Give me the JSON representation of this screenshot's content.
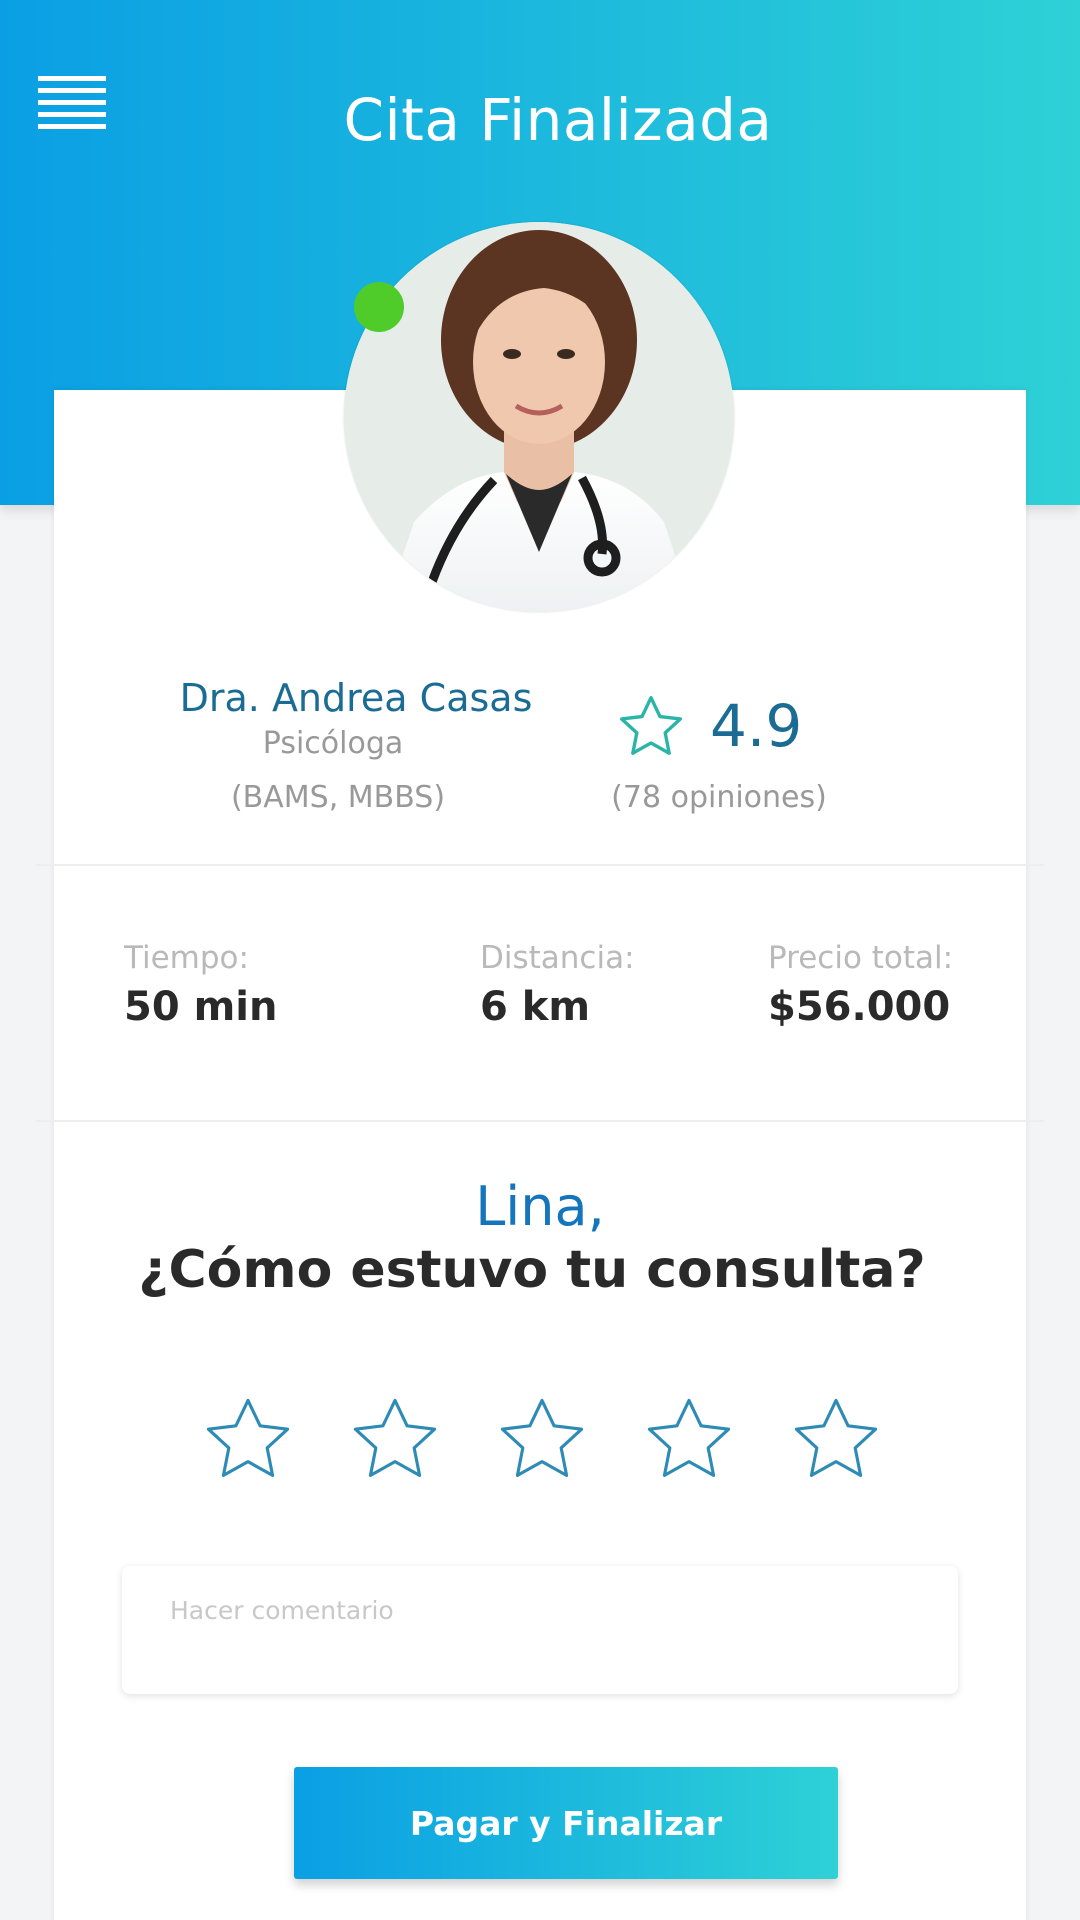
{
  "header": {
    "title": "Cita Finalizada",
    "menu_icon": "hamburger-menu-icon"
  },
  "doctor": {
    "name": "Dra. Andrea Casas",
    "specialty": "Psicóloga",
    "degrees": "(BAMS, MBBS)",
    "rating": "4.9",
    "reviews": "(78 opiniones)",
    "status": "online",
    "status_color": "#4fcc2a"
  },
  "stats": [
    {
      "label": "Tiempo:",
      "value": "50 min"
    },
    {
      "label": "Distancia:",
      "value": "6 km"
    },
    {
      "label": "Precio total:",
      "value": "$56.000"
    }
  ],
  "feedback": {
    "user_name": "Lina,",
    "question": "¿Cómo estuvo tu consulta?",
    "stars_selected": 0,
    "stars_total": 5,
    "comment_placeholder": "Hacer comentario",
    "comment_value": ""
  },
  "actions": {
    "pay_label": "Pagar y Finalizar"
  },
  "colors": {
    "gradient_start": "#0a9fe4",
    "gradient_end": "#2ed1d6",
    "name_blue": "#1b6c95",
    "star_outline": "#2e8bb5",
    "rating_star": "#2bb5a8"
  }
}
